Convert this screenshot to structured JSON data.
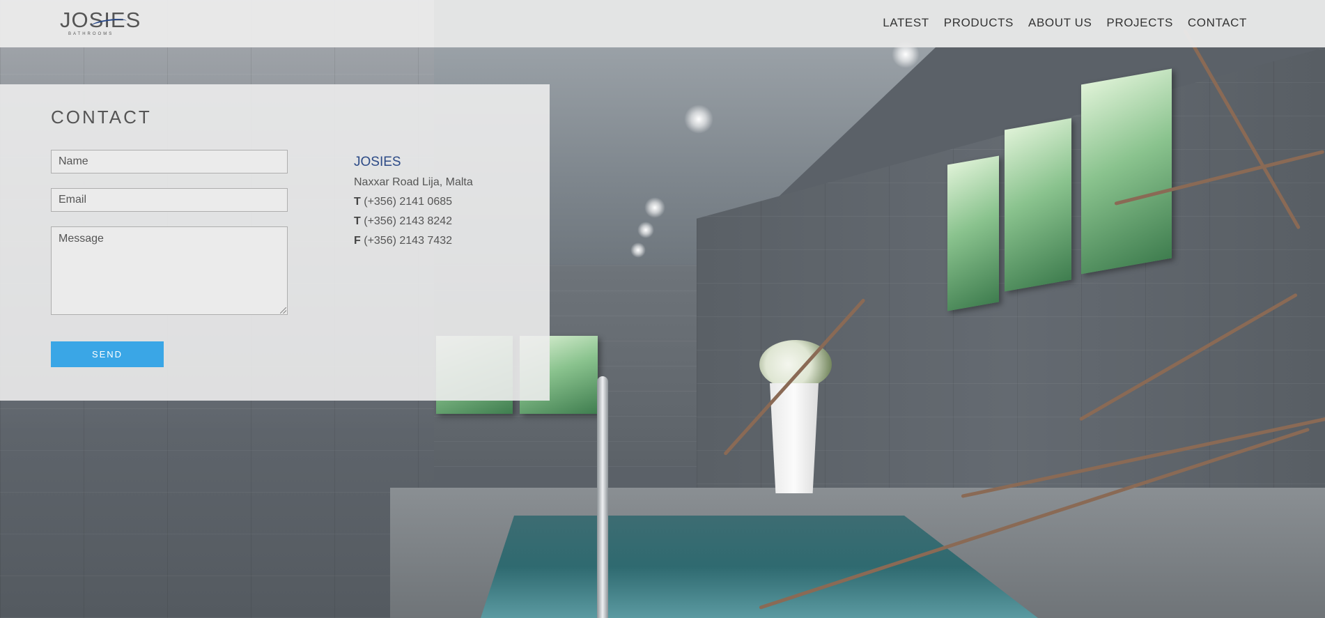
{
  "brand": {
    "logo_text": "JOSIES",
    "logo_subtext": "BATHROOMS",
    "accent_color": "#2c4a86",
    "button_color": "#3aa6e6"
  },
  "nav": {
    "items": [
      {
        "label": "LATEST"
      },
      {
        "label": "PRODUCTS"
      },
      {
        "label": "ABOUT US"
      },
      {
        "label": "PROJECTS"
      },
      {
        "label": "CONTACT"
      }
    ]
  },
  "contact_form": {
    "title": "CONTACT",
    "name_placeholder": "Name",
    "email_placeholder": "Email",
    "message_placeholder": "Message",
    "send_label": "SEND"
  },
  "contact_info": {
    "company": "JOSIES",
    "address": "Naxxar Road Lija, Malta",
    "phones": [
      {
        "prefix": "T",
        "number": "(+356) 2141 0685"
      },
      {
        "prefix": "T",
        "number": "(+356) 2143 8242"
      },
      {
        "prefix": "F",
        "number": "(+356) 2143 7432"
      }
    ]
  }
}
